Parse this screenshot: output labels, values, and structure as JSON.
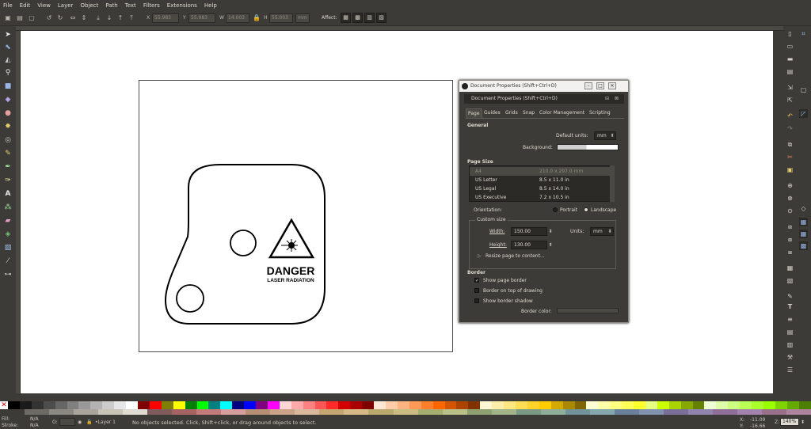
{
  "menu": [
    "File",
    "Edit",
    "View",
    "Layer",
    "Object",
    "Path",
    "Text",
    "Filters",
    "Extensions",
    "Help"
  ],
  "toolctrl": {
    "x_value": "55.983",
    "y_value": "55.983",
    "w_value": "14.003",
    "h_value": "55.003",
    "unit": "mm",
    "affect_label": "Affect:"
  },
  "drawing": {
    "danger_text": "DANGER",
    "laser_text": "LASER RADIATION"
  },
  "dialog": {
    "window_title": "Document Properties (Shift+Ctrl+D)",
    "panel_title": "Document Properties (Shift+Ctrl+D)",
    "tabs": [
      "Page",
      "Guides",
      "Grids",
      "Snap",
      "Color Management",
      "Scripting"
    ],
    "general_heading": "General",
    "default_units_label": "Default units:",
    "default_units_value": "mm",
    "background_label": "Background:",
    "page_size_heading": "Page Size",
    "page_sizes": [
      {
        "name": "A4",
        "size": "210.0 x 297.0 mm"
      },
      {
        "name": "US Letter",
        "size": "8.5 x 11.0 in"
      },
      {
        "name": "US Legal",
        "size": "8.5 x 14.0 in"
      },
      {
        "name": "US Executive",
        "size": "7.2 x 10.5 in"
      }
    ],
    "orientation_label": "Orientation:",
    "portrait_label": "Portrait",
    "landscape_label": "Landscape",
    "custom_size_label": "Custom size",
    "width_label": "Width:",
    "width_value": "150.00",
    "height_label": "Height:",
    "height_value": "130.00",
    "units_label": "Units:",
    "units_value": "mm",
    "resize_label": "Resize page to content...",
    "border_heading": "Border",
    "show_page_border": "Show page border",
    "border_on_top": "Border on top of drawing",
    "show_border_shadow": "Show border shadow",
    "border_color_label": "Border color:"
  },
  "status": {
    "fill_label": "Fill:",
    "fill_value": "N/A",
    "stroke_label": "Stroke:",
    "stroke_value": "N/A",
    "opacity_label": "O:",
    "layer": "•Layer 1",
    "message": "No objects selected. Click, Shift+click, or drag around objects to select.",
    "x_label": "X:",
    "x_value": "-11.09",
    "y_label": "Y:",
    "y_value": "-16.66",
    "zoom_label": "Z:",
    "zoom_value": "140%"
  },
  "colors": {
    "palette": [
      "#000000",
      "#1a1a1a",
      "#333333",
      "#4d4d4d",
      "#666666",
      "#808080",
      "#999999",
      "#b3b3b3",
      "#cccccc",
      "#e6e6e6",
      "#ffffff",
      "#800000",
      "#ff0000",
      "#808000",
      "#ffff00",
      "#008000",
      "#00ff00",
      "#008080",
      "#00ffff",
      "#000080",
      "#0000ff",
      "#800080",
      "#ff00ff",
      "#ffd5d5",
      "#ffaaaa",
      "#ff8080",
      "#ff5555",
      "#ff2a2a",
      "#d40000",
      "#aa0000",
      "#800000",
      "#ffe6d5",
      "#ffccaa",
      "#ffb380",
      "#ff9955",
      "#ff7f2a",
      "#ff6600",
      "#d45500",
      "#aa4400",
      "#803300",
      "#fff6d5",
      "#ffeeaa",
      "#ffe680",
      "#ffdd55",
      "#ffd42a",
      "#ffcc00",
      "#d4aa00",
      "#aa8800",
      "#806600",
      "#ffffd5",
      "#ffffaa",
      "#ffff80",
      "#ffff55",
      "#ffff2a",
      "#e5ff80",
      "#ccff00",
      "#aad400",
      "#88aa00",
      "#668000",
      "#eeffd5",
      "#ddffaa",
      "#ccff80",
      "#bbff55",
      "#aaff2a",
      "#99ff00",
      "#7fd400",
      "#66aa00",
      "#4d8000"
    ],
    "palette2": [
      "#3c3b37",
      "#6c6b66",
      "#8b8983",
      "#a9a59d",
      "#c8c3b7",
      "#dfdbd2",
      "#7f5b5b",
      "#a76363",
      "#c27a7a",
      "#d69d9d",
      "#b78f77",
      "#c9a287",
      "#d9b89d",
      "#c5a570",
      "#d6b986",
      "#b9a96d",
      "#cbbc84",
      "#a6ad70",
      "#b9c087",
      "#8ea070",
      "#a0b389",
      "#7b9a84",
      "#8fae99",
      "#6f9399",
      "#84a7ad",
      "#6a7f99",
      "#8092ad",
      "#7a6f99",
      "#9083ad",
      "#8f6f99",
      "#a383ad",
      "#996f8a",
      "#ad839e"
    ]
  }
}
